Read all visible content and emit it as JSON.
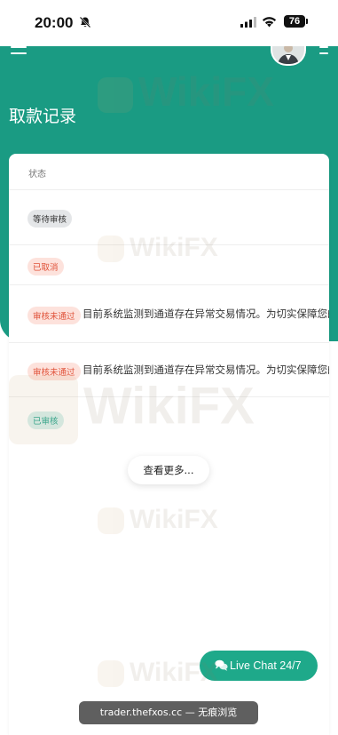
{
  "status_bar": {
    "time": "20:00",
    "battery": "76"
  },
  "page": {
    "title": "取款记录"
  },
  "table": {
    "column_header": "状态",
    "rows": [
      {
        "status": "等待审核",
        "status_color": "#e4e6e8",
        "reason": ""
      },
      {
        "status": "已取消",
        "status_color": "#fde2dc",
        "reason": ""
      },
      {
        "status": "审核未通过",
        "status_color": "#fde2dc",
        "reason": "目前系统监测到通道存在异常交易情况。为切实保障您的"
      },
      {
        "status": "审核未通过",
        "status_color": "#fde2dc",
        "reason": "目前系统监测到通道存在异常交易情况。为切实保障您的"
      },
      {
        "status": "已审核",
        "status_color": "#d6f0ec",
        "reason": ""
      }
    ]
  },
  "load_more": "查看更多...",
  "live_chat": "Live Chat 24/7",
  "browser_url": "trader.thefxos.cc — 无痕浏览",
  "watermark": "WikiFX",
  "colors": {
    "accent": "#1a9b83",
    "chat_button": "#1ea98a",
    "danger": "#e0533a"
  }
}
